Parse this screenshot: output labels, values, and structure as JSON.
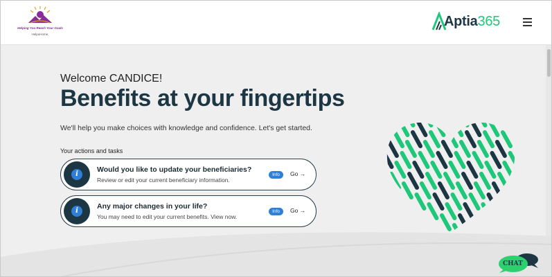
{
  "header": {
    "client_logo": {
      "tagline": "Helping You Reach Your Goals",
      "sub": "HelpuHome,",
      "colors": {
        "primary": "#8a2d9c",
        "accent": "#d9a21c"
      }
    },
    "brand": {
      "name": "Aptia",
      "number": "365",
      "colors": {
        "name": "#1c3644",
        "number": "#1ec77a"
      }
    },
    "menu_icon": "hamburger-menu-icon"
  },
  "main": {
    "welcome": "Welcome CANDICE!",
    "title": "Benefits at your fingertips",
    "subtitle": "We'll help you make choices with knowledge and confidence. Let's get started.",
    "tasks_label": "Your actions and tasks",
    "tasks": [
      {
        "title": "Would you like to update your beneficiaries?",
        "description": "Review or edit your current beneficiary information.",
        "badge": "Info",
        "link": "Go →",
        "icon": "info-icon"
      },
      {
        "title": "Any major changes in your life?",
        "description": "You may need to edit your current benefits. View now.",
        "badge": "Info",
        "link": "Go →",
        "icon": "info-icon"
      }
    ],
    "decoration_icon": "striped-heart-illustration",
    "colors": {
      "navy": "#1c3644",
      "green": "#1ec77a",
      "info_blue": "#2f7fd6"
    }
  },
  "chat": {
    "label": "CHAT",
    "icon": "chat-bubble-icon",
    "colors": {
      "bubble": "#2ed06e",
      "back": "#1c3644"
    }
  }
}
